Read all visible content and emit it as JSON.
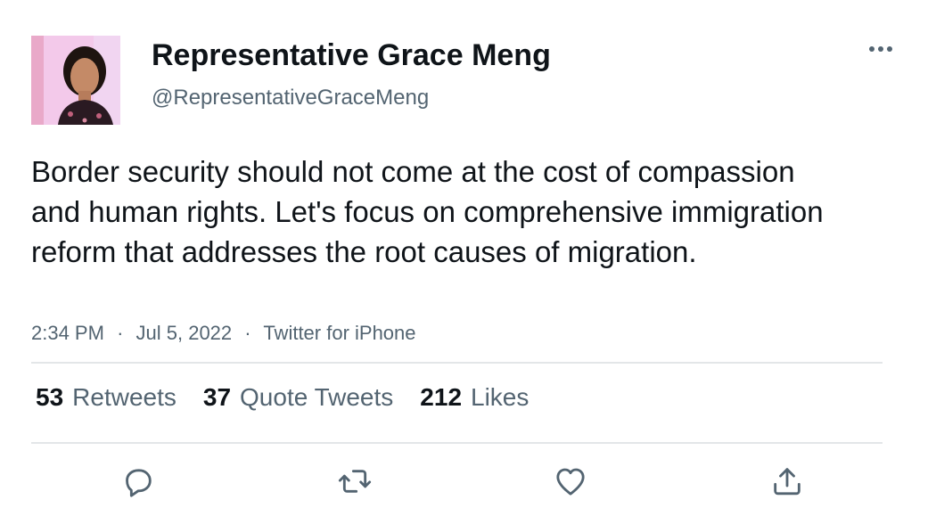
{
  "author": {
    "display_name": "Representative Grace Meng",
    "handle": "@RepresentativeGraceMeng"
  },
  "tweet": {
    "text": "Border security should not come at the cost of compassion and human rights. Let's focus on comprehensive immigration reform that addresses the root causes of migration.",
    "time": "2:34 PM",
    "separator": "·",
    "date": "Jul 5, 2022",
    "source": "Twitter for iPhone"
  },
  "stats": {
    "retweets_count": "53",
    "retweets_label": "Retweets",
    "quote_tweets_count": "37",
    "quote_tweets_label": "Quote Tweets",
    "likes_count": "212",
    "likes_label": "Likes"
  },
  "icons": {
    "more": "more-horizontal-icon",
    "reply": "reply-icon",
    "retweet": "retweet-icon",
    "like": "heart-icon",
    "share": "share-icon"
  },
  "colors": {
    "text_primary": "#0f1419",
    "text_secondary": "#536471",
    "divider": "#e3e6e8",
    "avatar_background": "#f7c6e6"
  }
}
